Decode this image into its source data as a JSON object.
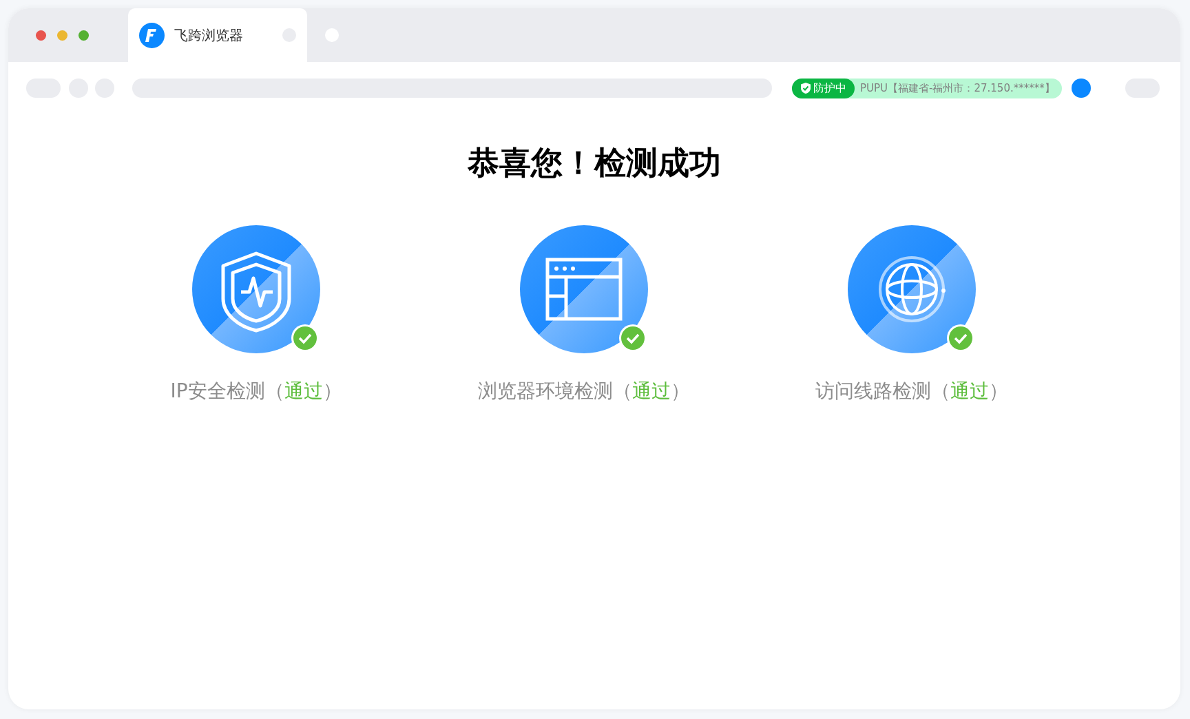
{
  "tab": {
    "title": "飞跨浏览器",
    "selected": true
  },
  "address_bar": {
    "protection_status": "防护中",
    "location": "PUPU【福建省-福州市：27.150.******】"
  },
  "heading": "恭喜您！检测成功",
  "checks": [
    {
      "kind": "shield",
      "name": "IP安全检测（",
      "result": "通过",
      "close": "）",
      "passed": true
    },
    {
      "kind": "browser",
      "name": "浏览器环境检测（",
      "result": "通过",
      "close": "）",
      "passed": true
    },
    {
      "kind": "globe",
      "name": "访问线路检测（",
      "result": "通过",
      "close": "）",
      "passed": true
    }
  ]
}
